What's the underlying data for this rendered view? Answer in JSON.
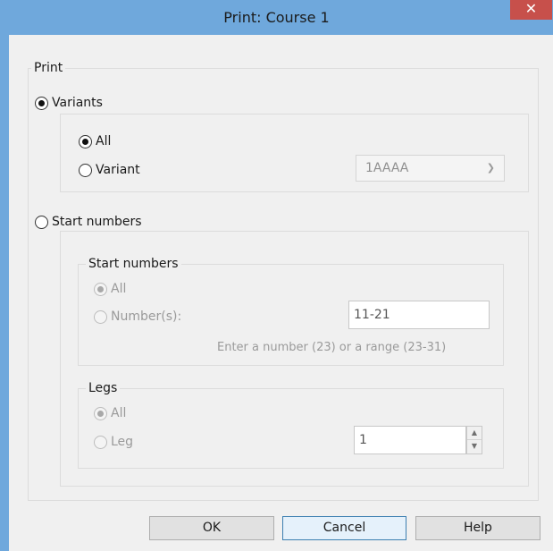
{
  "window": {
    "title": "Print: Course 1",
    "close_glyph": "✕"
  },
  "print_group": {
    "label": "Print",
    "variants_label": "Variants",
    "variants_checked": true,
    "variants_sub": {
      "all_label": "All",
      "all_checked": true,
      "variant_label": "Variant",
      "variant_checked": false,
      "variant_select_value": "1AAAA"
    },
    "start_numbers_label": "Start numbers",
    "start_numbers_checked": false,
    "start_numbers_group": {
      "label": "Start numbers",
      "all_label": "All",
      "all_checked": true,
      "numbers_label": "Number(s):",
      "numbers_value": "11-21",
      "hint": "Enter a number (23) or a range (23-31)"
    },
    "legs_group": {
      "label": "Legs",
      "all_label": "All",
      "all_checked": true,
      "leg_label": "Leg",
      "leg_value": "1"
    }
  },
  "buttons": {
    "ok": "OK",
    "cancel": "Cancel",
    "help": "Help"
  },
  "icons": {
    "close": "close-icon",
    "chevron": "chevron-down-icon",
    "spin_up": "spin-up-icon",
    "spin_down": "spin-down-icon"
  },
  "colors": {
    "titlebar": "#6fa8dc",
    "close_button": "#c7504b",
    "client_bg": "#f0f0f0"
  }
}
